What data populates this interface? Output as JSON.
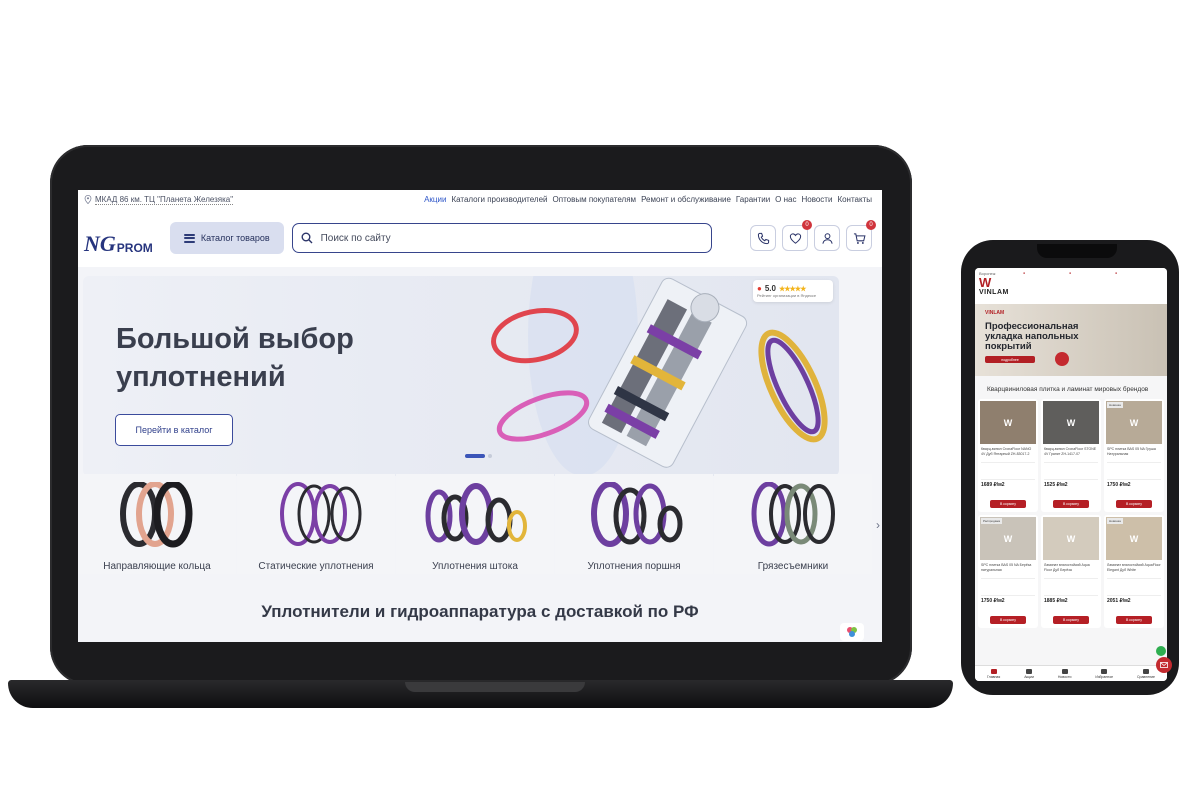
{
  "laptop": {
    "topbar": {
      "address": "МКАД 86 км. ТЦ \"Планета Железяка\"",
      "nav": [
        "Акции",
        "Каталоги производителей",
        "Оптовым покупателям",
        "Ремонт и обслуживание",
        "Гарантии",
        "О нас",
        "Новости",
        "Контакты"
      ]
    },
    "header": {
      "logo_mark": "NG",
      "logo_word": "PROM",
      "catalog_label": "Каталог товаров",
      "search_placeholder": "Поиск по сайту",
      "favorites_count": "0",
      "cart_count": "0"
    },
    "hero": {
      "title": "Большой выбор уплотнений",
      "button": "Перейти в каталог",
      "rating_value": "5.0",
      "rating_stars": "★★★★★",
      "rating_caption": "Рейтинг организации в Яндексе"
    },
    "categories": [
      {
        "label": "Направляющие кольца"
      },
      {
        "label": "Статические уплотнения"
      },
      {
        "label": "Уплотнения штока"
      },
      {
        "label": "Уплотнения поршня"
      },
      {
        "label": "Грязесъемники"
      }
    ],
    "section_title": "Уплотнители и гидроаппаратура с доставкой по РФ",
    "accent_color": "#2f57c9",
    "brand_color": "#26347e"
  },
  "phone": {
    "logo_city": "Воронеж",
    "logo_mark": "W",
    "logo_word": "VINLAM",
    "banner_brand": "VINLAM",
    "banner_title": "Профессиональная укладка напольных покрытий",
    "banner_button": "подробнее",
    "section_title": "Кварцвиниловая плитка и ламинат мировых брендов",
    "cart_label": "В корзину",
    "products": [
      {
        "tag": "",
        "name": "Кварц-винил CronaFloor NANO 4V Дуб Янтарный ZH-83017-2",
        "price": "1689 ₽/м2"
      },
      {
        "tag": "",
        "name": "Кварц-винил CronaFloor STONE 4V Гранит ZH-1417-07",
        "price": "1525 ₽/м2"
      },
      {
        "tag": "Новинка",
        "name": "SPC плитка BAS 05 NA Груша Натуральная",
        "price": "1750 ₽/м2"
      },
      {
        "tag": "Распродажа",
        "name": "SPC плитка BAS 05 NA Берёза натуральная",
        "price": "1750 ₽/м2"
      },
      {
        "tag": "",
        "name": "Ламинат влагостойкий Aqua Floor Дуб Берёза",
        "price": "1885 ₽/м2"
      },
      {
        "tag": "Новинка",
        "name": "Ламинат влагостойкий AquaFloor Elegant Дуб White",
        "price": "2051 ₽/м2"
      }
    ],
    "nav": [
      "Главная",
      "Акции",
      "Новости",
      "Избранное",
      "Сравнение"
    ],
    "brand_color": "#b21f24"
  }
}
